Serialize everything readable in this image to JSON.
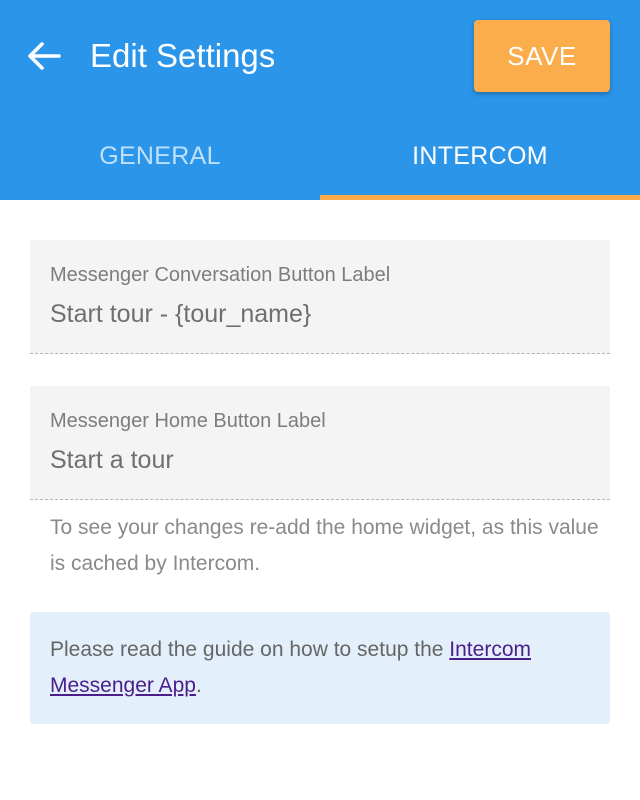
{
  "header": {
    "back_icon": "arrow-left-icon",
    "title": "Edit Settings",
    "save_label": "SAVE",
    "background_color": "#2b95ea",
    "accent_color": "#fbac4b"
  },
  "tabs": [
    {
      "label": "GENERAL",
      "active": false
    },
    {
      "label": "INTERCOM",
      "active": true
    }
  ],
  "fields": [
    {
      "label": "Messenger Conversation Button Label",
      "value": "Start tour - {tour_name}"
    },
    {
      "label": "Messenger Home Button Label",
      "value": "Start a tour"
    }
  ],
  "hint": "To see your changes re-add the home widget, as this value is cached by Intercom.",
  "notice": {
    "text_before": "Please read the guide on how to setup the ",
    "link_text": "Intercom Messenger App",
    "text_after": "."
  }
}
